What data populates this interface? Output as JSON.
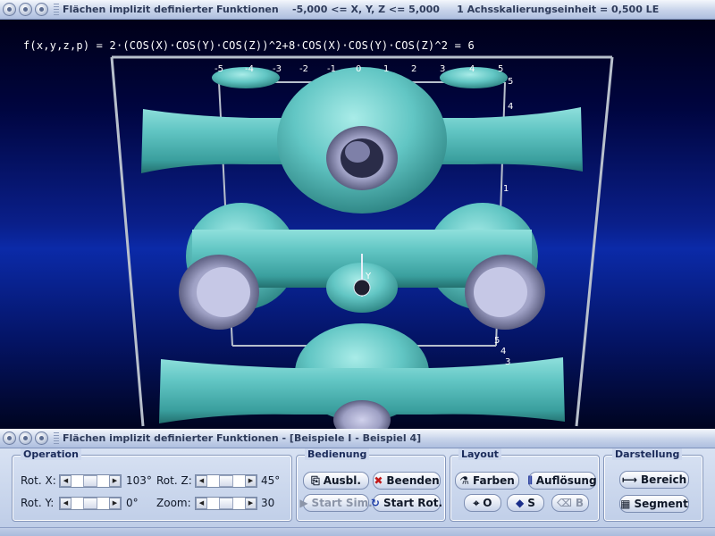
{
  "window_top": {
    "title": "Flächen implizit definierter Funktionen    -5,000 <= X, Y, Z <= 5,000     1 Achsskalierungseinheit = 0,500 LE"
  },
  "view": {
    "formula": "f(x,y,z,p) = 2·(COS(X)·COS(Y)·COS(Z))^2+8·COS(X)·COS(Y)·COS(Z)^2 = 6",
    "x_ticks": [
      "-5",
      "-4",
      "-3",
      "-2",
      "-1",
      "0",
      "1",
      "2",
      "3",
      "4",
      "5"
    ],
    "z_ticks": [
      "5",
      "4",
      "1",
      "5",
      "4",
      "3"
    ],
    "axis_label": "Y",
    "colors": {
      "surface": "#62c6c4",
      "surface_dark": "#2f8d8c",
      "hole": "#9ea0c4",
      "frame": "#b8c0cc"
    }
  },
  "window_bottom": {
    "title": "Flächen implizit definierter Funktionen - [Beispiele I - Beispiel 4]"
  },
  "operation": {
    "label": "Operation",
    "rot_x_label": "Rot. X:",
    "rot_x_value": "103°",
    "rot_y_label": "Rot. Y:",
    "rot_y_value": "0°",
    "rot_z_label": "Rot. Z:",
    "rot_z_value": "45°",
    "zoom_label": "Zoom:",
    "zoom_value": "30"
  },
  "bedienung": {
    "label": "Bedienung",
    "ausbl": "Ausbl.",
    "beenden": "Beenden",
    "start_sim": "Start Sim.",
    "start_rot": "Start Rot."
  },
  "layout": {
    "label": "Layout",
    "farben": "Farben",
    "aufloesung": "Auflösung",
    "o": "O",
    "s": "S",
    "b": "B"
  },
  "darstellung": {
    "label": "Darstellung",
    "bereich": "Bereich",
    "segment": "Segment"
  }
}
